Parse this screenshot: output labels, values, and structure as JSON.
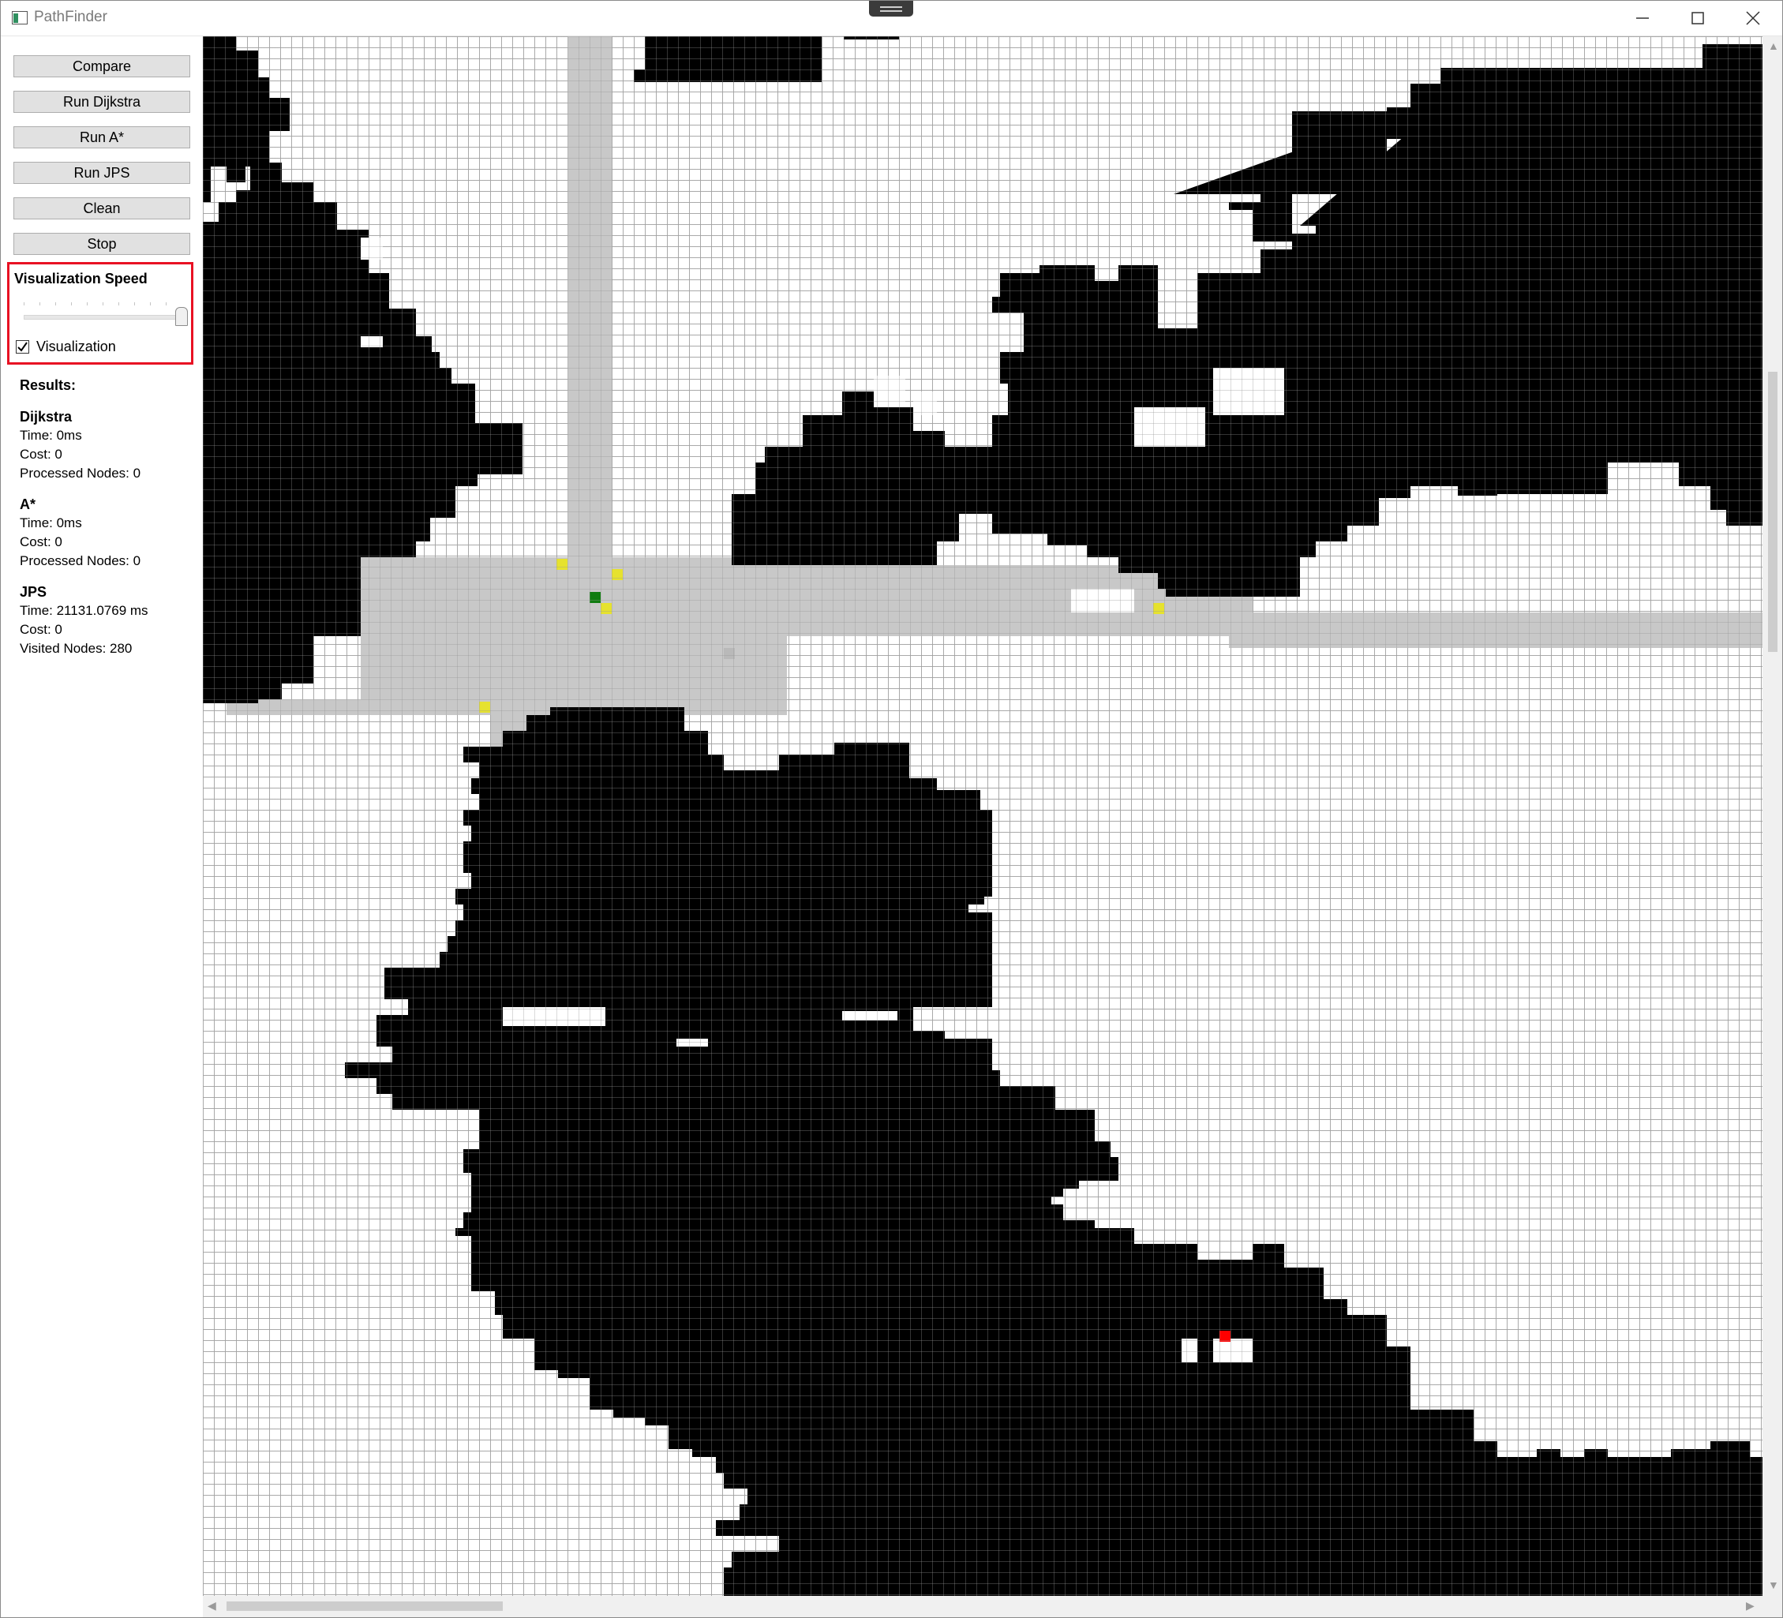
{
  "window": {
    "title": "PathFinder"
  },
  "buttons": {
    "compare": "Compare",
    "run_dijkstra": "Run Dijkstra",
    "run_astar": "Run A*",
    "run_jps": "Run JPS",
    "clean": "Clean",
    "stop": "Stop"
  },
  "visualization": {
    "speed_title": "Visualization Speed",
    "speed_value": 1.0,
    "checkbox_label": "Visualization",
    "checkbox_checked": true
  },
  "results": {
    "heading": "Results:",
    "dijkstra": {
      "name": "Dijkstra",
      "time": "Time: 0ms",
      "cost": "Cost: 0",
      "nodes": "Processed Nodes: 0"
    },
    "astar": {
      "name": "A*",
      "time": "Time: 0ms",
      "cost": "Cost: 0",
      "nodes": "Processed Nodes: 0"
    },
    "jps": {
      "name": "JPS",
      "time": "Time: 21131.0769 ms",
      "cost": "Cost: 0",
      "nodes": "Visited Nodes: 280"
    }
  },
  "colors": {
    "obstacle": "#000000",
    "visited": "#c8c8c8",
    "start": "#107c10",
    "goal": "#ff0000",
    "jump_point": "#e6e22e",
    "highlight_border": "#e81123"
  },
  "icons": {
    "app": "app-window-icon",
    "minimize": "minimize-icon",
    "maximize": "maximize-icon",
    "close": "close-icon",
    "checkbox": "checkmark-icon"
  }
}
